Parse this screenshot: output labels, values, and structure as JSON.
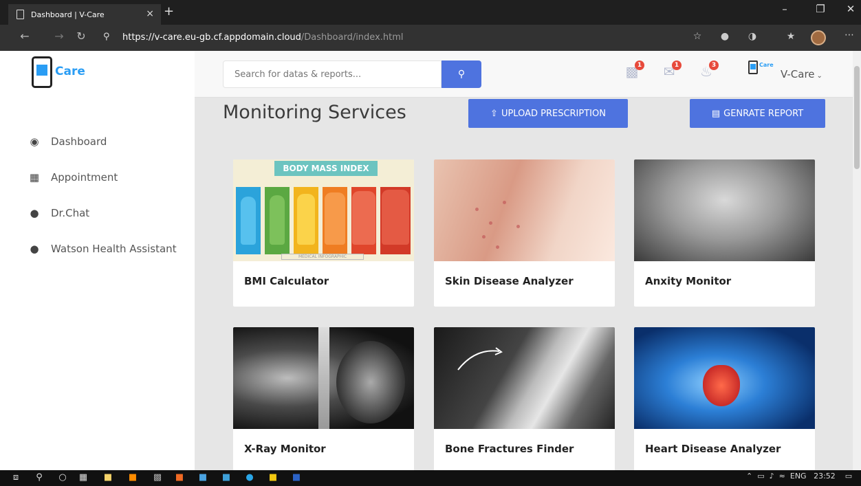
{
  "browser": {
    "tab_title": "Dashboard | V-Care",
    "tab_close": "×",
    "new_tab": "+",
    "url_host": "https://v-care.eu-gb.cf.appdomain.cloud",
    "url_path": "/Dashboard/index.html"
  },
  "app": {
    "logo_text": "Care",
    "search_placeholder": "Search for datas & reports...",
    "notifications": {
      "chat": "1",
      "mail": "1",
      "alerts": "3"
    },
    "user_logo_text": "Care",
    "user_name": "V-Care"
  },
  "sidebar": {
    "items": [
      {
        "label": "Dashboard",
        "icon": "tachometer-icon"
      },
      {
        "label": "Appointment",
        "icon": "calendar-icon"
      },
      {
        "label": "Dr.Chat",
        "icon": "chat-icon"
      },
      {
        "label": "Watson Health Assistant",
        "icon": "user-icon"
      }
    ]
  },
  "main": {
    "heading": "Monitoring Services",
    "upload_button": "UPLOAD PRESCRIPTION",
    "report_button": "GENRATE REPORT",
    "cards": [
      {
        "title": "BMI Calculator"
      },
      {
        "title": "Skin Disease Analyzer"
      },
      {
        "title": "Anxity Monitor"
      },
      {
        "title": "X-Ray Monitor"
      },
      {
        "title": "Bone Fractures Finder"
      },
      {
        "title": "Heart Disease Analyzer"
      }
    ],
    "bmi_banner": "BODY MASS INDEX",
    "bmi_footer": "MEDICAL INFOGRAPHIC"
  },
  "taskbar": {
    "language": "ENG",
    "time": "23:52"
  },
  "colors": {
    "primary": "#4e73df",
    "brand": "#2a9df4",
    "badge": "#e74a3b"
  }
}
